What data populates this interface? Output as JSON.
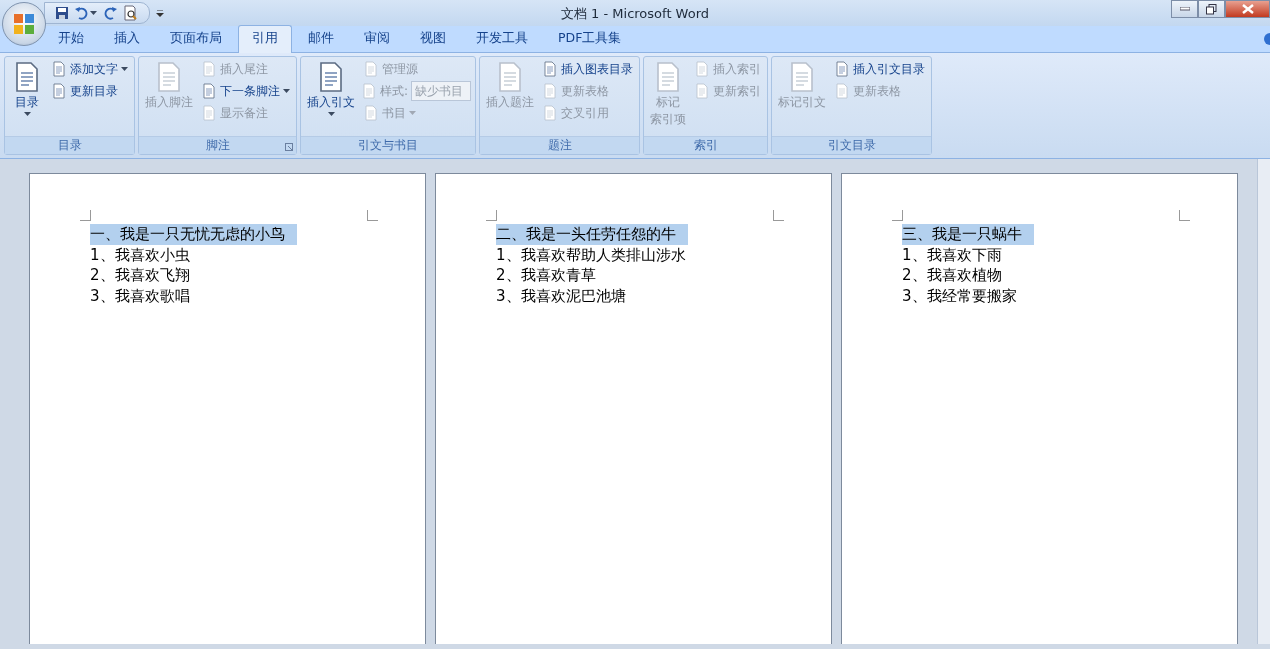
{
  "window": {
    "title": "文档 1 - Microsoft Word"
  },
  "tabs": [
    {
      "label": "开始",
      "selected": false
    },
    {
      "label": "插入",
      "selected": false
    },
    {
      "label": "页面布局",
      "selected": false
    },
    {
      "label": "引用",
      "selected": true
    },
    {
      "label": "邮件",
      "selected": false
    },
    {
      "label": "审阅",
      "selected": false
    },
    {
      "label": "视图",
      "selected": false
    },
    {
      "label": "开发工具",
      "selected": false
    },
    {
      "label": "PDF工具集",
      "selected": false
    }
  ],
  "ribbon": {
    "groups": [
      {
        "label": "目录",
        "launcher": false,
        "items": [
          {
            "kind": "large",
            "lines": [
              "目录"
            ],
            "disabled": false,
            "dropdown": true
          },
          {
            "kind": "small",
            "label": "添加文字",
            "disabled": false,
            "dropdown": true
          },
          {
            "kind": "small",
            "label": "更新目录",
            "disabled": false,
            "dropdown": false
          }
        ]
      },
      {
        "label": "脚注",
        "launcher": true,
        "items": [
          {
            "kind": "large",
            "lines": [
              "插入脚注"
            ],
            "disabled": true,
            "dropdown": false
          },
          {
            "kind": "small",
            "label": "插入尾注",
            "disabled": true,
            "dropdown": false
          },
          {
            "kind": "small",
            "label": "下一条脚注",
            "disabled": false,
            "dropdown": true
          },
          {
            "kind": "small",
            "label": "显示备注",
            "disabled": true,
            "dropdown": false
          }
        ]
      },
      {
        "label": "引文与书目",
        "launcher": false,
        "items": [
          {
            "kind": "large",
            "lines": [
              "插入引文"
            ],
            "disabled": false,
            "dropdown": true
          },
          {
            "kind": "small",
            "label": "管理源",
            "disabled": true,
            "dropdown": false
          },
          {
            "kind": "combo",
            "label": "样式:",
            "value": "缺少书目",
            "disabled": true,
            "dropdown": true
          },
          {
            "kind": "small",
            "label": "书目",
            "disabled": true,
            "dropdown": true
          }
        ]
      },
      {
        "label": "题注",
        "launcher": false,
        "items": [
          {
            "kind": "large",
            "lines": [
              "插入题注"
            ],
            "disabled": true,
            "dropdown": false
          },
          {
            "kind": "small",
            "label": "插入图表目录",
            "disabled": false,
            "dropdown": false
          },
          {
            "kind": "small",
            "label": "更新表格",
            "disabled": true,
            "dropdown": false
          },
          {
            "kind": "small",
            "label": "交叉引用",
            "disabled": true,
            "dropdown": false
          }
        ]
      },
      {
        "label": "索引",
        "launcher": false,
        "items": [
          {
            "kind": "large",
            "lines": [
              "标记",
              "索引项"
            ],
            "disabled": true,
            "dropdown": false
          },
          {
            "kind": "small",
            "label": "插入索引",
            "disabled": true,
            "dropdown": false
          },
          {
            "kind": "small",
            "label": "更新索引",
            "disabled": true,
            "dropdown": false
          }
        ]
      },
      {
        "label": "引文目录",
        "launcher": false,
        "items": [
          {
            "kind": "large",
            "lines": [
              "标记引文"
            ],
            "disabled": true,
            "dropdown": false
          },
          {
            "kind": "small",
            "label": "插入引文目录",
            "disabled": false,
            "dropdown": false
          },
          {
            "kind": "small",
            "label": "更新表格",
            "disabled": true,
            "dropdown": false
          }
        ]
      }
    ]
  },
  "pages": [
    {
      "lines": [
        {
          "text": "一、我是一只无忧无虑的小鸟",
          "selected": true
        },
        {
          "text": "1、我喜欢小虫",
          "selected": false
        },
        {
          "text": "2、我喜欢飞翔",
          "selected": false
        },
        {
          "text": "3、我喜欢歌唱",
          "selected": false
        }
      ]
    },
    {
      "lines": [
        {
          "text": "二、我是一头任劳任怨的牛",
          "selected": true
        },
        {
          "text": "1、我喜欢帮助人类排山涉水",
          "selected": false
        },
        {
          "text": "2、我喜欢青草",
          "selected": false
        },
        {
          "text": "3、我喜欢泥巴池塘",
          "selected": false
        }
      ]
    },
    {
      "lines": [
        {
          "text": "三、我是一只蜗牛",
          "selected": true
        },
        {
          "text": "1、我喜欢下雨",
          "selected": false
        },
        {
          "text": "2、我喜欢植物",
          "selected": false
        },
        {
          "text": "3、我经常要搬家",
          "selected": false
        }
      ]
    }
  ]
}
